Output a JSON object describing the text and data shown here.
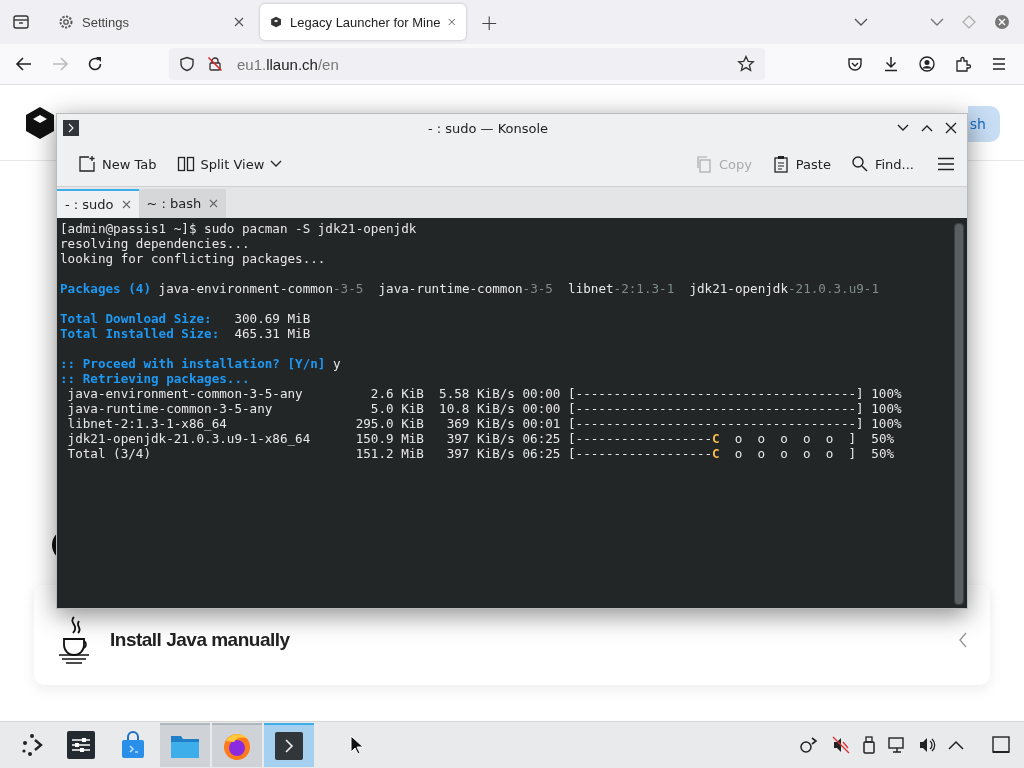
{
  "browser": {
    "tabs": [
      {
        "kind": "settings",
        "label": "Settings",
        "selected": false
      },
      {
        "kind": "cube",
        "label": "Legacy Launcher for Mine",
        "selected": true
      }
    ],
    "new_tab": "+",
    "url": {
      "prefix": "eu1.",
      "domain": "llaun.ch",
      "path": "/en"
    }
  },
  "page": {
    "button_text": "sh",
    "card_title": "Install Java manually"
  },
  "konsole": {
    "title": "- : sudo — Konsole",
    "toolbar": [
      {
        "kind": "newtab",
        "label": "New Tab",
        "disabled": false
      },
      {
        "kind": "split",
        "label": "Split View",
        "disabled": false
      },
      {
        "kind": "copy",
        "label": "Copy",
        "disabled": true
      },
      {
        "kind": "paste",
        "label": "Paste",
        "disabled": false
      },
      {
        "kind": "find",
        "label": "Find...",
        "disabled": false
      }
    ],
    "tabs": [
      {
        "label": "- : sudo",
        "selected": true
      },
      {
        "label": "~ : bash",
        "selected": false
      }
    ],
    "output_blocks": [
      [
        [
          {
            "kind": "plain",
            "text": "[admin@passis1 ~]$ sudo pacman -S jdk21-openjdk"
          }
        ],
        [
          {
            "kind": "plain",
            "text": "resolving dependencies..."
          }
        ],
        [
          {
            "kind": "plain",
            "text": "looking for conflicting packages..."
          }
        ]
      ],
      [
        [
          {
            "kind": "label",
            "text": "Packages (4)"
          },
          {
            "kind": "plain",
            "text": " java-environment-common"
          },
          {
            "kind": "dim",
            "text": "-3-5"
          },
          {
            "kind": "plain",
            "text": "  java-runtime-common"
          },
          {
            "kind": "dim",
            "text": "-3-5"
          },
          {
            "kind": "plain",
            "text": "  libnet"
          },
          {
            "kind": "dim",
            "text": "-2:1.3-1"
          },
          {
            "kind": "plain",
            "text": "  jdk21-openjdk"
          },
          {
            "kind": "dim",
            "text": "-21.0.3.u9-1"
          }
        ]
      ],
      [
        [
          {
            "kind": "label",
            "text": "Total Download Size:"
          },
          {
            "kind": "plain",
            "text": "   300.69 MiB"
          }
        ],
        [
          {
            "kind": "label",
            "text": "Total Installed Size:"
          },
          {
            "kind": "plain",
            "text": "  465.31 MiB"
          }
        ]
      ],
      [
        [
          {
            "kind": "label",
            "text": ":: Proceed with installation? [Y/n]"
          },
          {
            "kind": "plain",
            "text": " y"
          }
        ],
        [
          {
            "kind": "label",
            "text": ":: Retrieving packages..."
          }
        ],
        [
          {
            "kind": "plain",
            "text": " java-environment-common-3-5-any         2.6 KiB  5.58 KiB/s 00:00 [-------------------------------------] 100%"
          }
        ],
        [
          {
            "kind": "plain",
            "text": " java-runtime-common-3-5-any             5.0 KiB  10.8 KiB/s 00:00 [-------------------------------------] 100%"
          }
        ],
        [
          {
            "kind": "plain",
            "text": " libnet-2:1.3-1-x86_64                 295.0 KiB   369 KiB/s 00:01 [-------------------------------------] 100%"
          }
        ],
        [
          {
            "kind": "plain",
            "text": " jdk21-openjdk-21.0.3.u9-1-x86_64      150.9 MiB   397 KiB/s 06:25 [------------------"
          },
          {
            "kind": "accent",
            "text": "C"
          },
          {
            "kind": "plain",
            "text": "  o  o  o  o  o  ]  50%"
          }
        ],
        [
          {
            "kind": "plain",
            "text": " Total (3/4)                           151.2 MiB   397 KiB/s 06:25 [------------------"
          },
          {
            "kind": "accent",
            "text": "C"
          },
          {
            "kind": "plain",
            "text": "  o  o  o  o  o  ]  50%"
          }
        ]
      ]
    ]
  },
  "taskbar": {
    "apps": [
      {
        "kind": "settings",
        "running": false,
        "active": false
      },
      {
        "kind": "store",
        "running": false,
        "active": false
      },
      {
        "kind": "files",
        "running": true,
        "active": false
      },
      {
        "kind": "firefox",
        "running": true,
        "active": false
      },
      {
        "kind": "terminal",
        "running": true,
        "active": true
      }
    ]
  }
}
